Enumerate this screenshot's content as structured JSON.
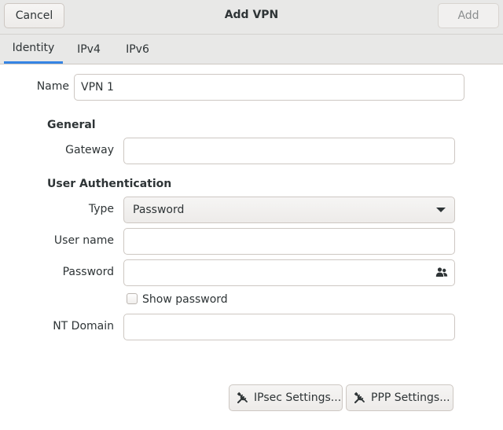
{
  "header": {
    "title": "Add VPN",
    "cancel_label": "Cancel",
    "add_label": "Add"
  },
  "tabs": [
    {
      "label": "Identity",
      "active": true
    },
    {
      "label": "IPv4",
      "active": false
    },
    {
      "label": "IPv6",
      "active": false
    }
  ],
  "identity": {
    "name_label": "Name",
    "name_value": "VPN 1"
  },
  "general": {
    "title": "General",
    "gateway_label": "Gateway",
    "gateway_value": ""
  },
  "auth": {
    "title": "User Authentication",
    "type_label": "Type",
    "type_value": "Password",
    "username_label": "User name",
    "username_value": "",
    "password_label": "Password",
    "password_value": "",
    "show_password_label": "Show password",
    "show_password_checked": false,
    "nt_domain_label": "NT Domain",
    "nt_domain_value": ""
  },
  "buttons": {
    "ipsec_label": "IPsec Settings...",
    "ppp_label": "PPP Settings..."
  },
  "colors": {
    "accent": "#3584e4",
    "headerbar": "#e8e8e7"
  },
  "icons": {
    "password_storage": "people-icon",
    "settings": "tools-icon"
  }
}
